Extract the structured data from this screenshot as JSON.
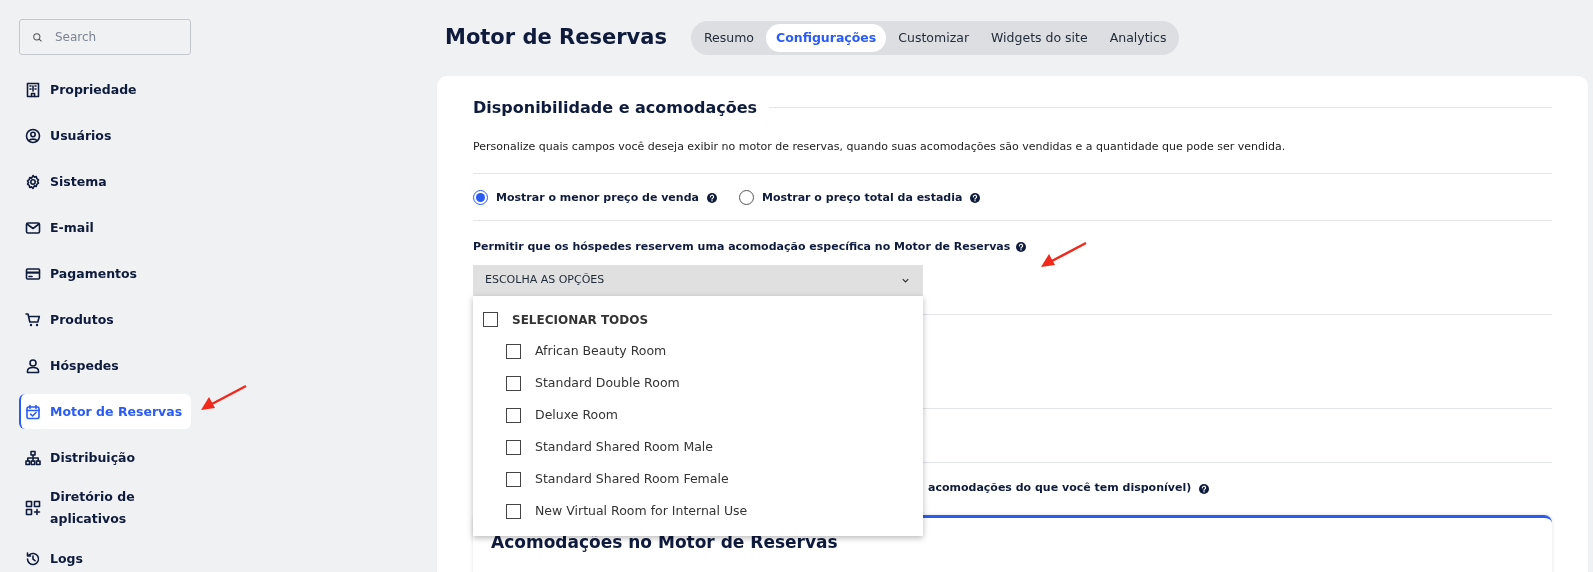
{
  "sidebar": {
    "search": {
      "placeholder": "Search"
    },
    "items": [
      {
        "label": "Propriedade",
        "selected": false
      },
      {
        "label": "Usuários",
        "selected": false
      },
      {
        "label": "Sistema",
        "selected": false
      },
      {
        "label": "E-mail",
        "selected": false
      },
      {
        "label": "Pagamentos",
        "selected": false
      },
      {
        "label": "Produtos",
        "selected": false
      },
      {
        "label": "Hóspedes",
        "selected": false
      },
      {
        "label": "Motor de Reservas",
        "selected": true
      },
      {
        "label": "Distribuição",
        "selected": false
      },
      {
        "label": "Diretório de aplicativos",
        "selected": false
      },
      {
        "label": "Logs",
        "selected": false
      }
    ]
  },
  "header": {
    "title": "Motor de Reservas",
    "tabs": [
      {
        "label": "Resumo",
        "selected": false
      },
      {
        "label": "Configurações",
        "selected": true
      },
      {
        "label": "Customizar",
        "selected": false
      },
      {
        "label": "Widgets do site",
        "selected": false
      },
      {
        "label": "Analytics",
        "selected": false
      }
    ]
  },
  "section": {
    "title": "Disponibilidade e acomodações",
    "description": "Personalize quais campos você deseja exibir no motor de reservas, quando suas acomodações são vendidas e a quantidade que pode ser vendida.",
    "price_options": [
      {
        "label": "Mostrar o menor preço de venda",
        "selected": true
      },
      {
        "label": "Mostrar o preço total da estadia",
        "selected": false
      }
    ],
    "permission": {
      "label": "Permitir que os hóspedes reservem uma acomodação específica no Motor de Reservas",
      "dropdown": {
        "value": "ESCOLHA AS OPÇÕES",
        "expanded": true,
        "select_all": {
          "label": "SELECIONAR TODOS",
          "checked": false
        },
        "options": [
          {
            "label": "African Beauty Room",
            "checked": false
          },
          {
            "label": "Standard Double Room",
            "checked": false
          },
          {
            "label": "Deluxe Room",
            "checked": false
          },
          {
            "label": "Standard Shared Room Male",
            "checked": false
          },
          {
            "label": "Standard Shared Room Female",
            "checked": false
          },
          {
            "label": "New Virtual Room for Internal Use",
            "checked": false
          }
        ]
      }
    },
    "partial_label": "acomodações do que você tem disponível)",
    "subsection": {
      "title": "Acomodações no Motor de Reservas"
    }
  }
}
